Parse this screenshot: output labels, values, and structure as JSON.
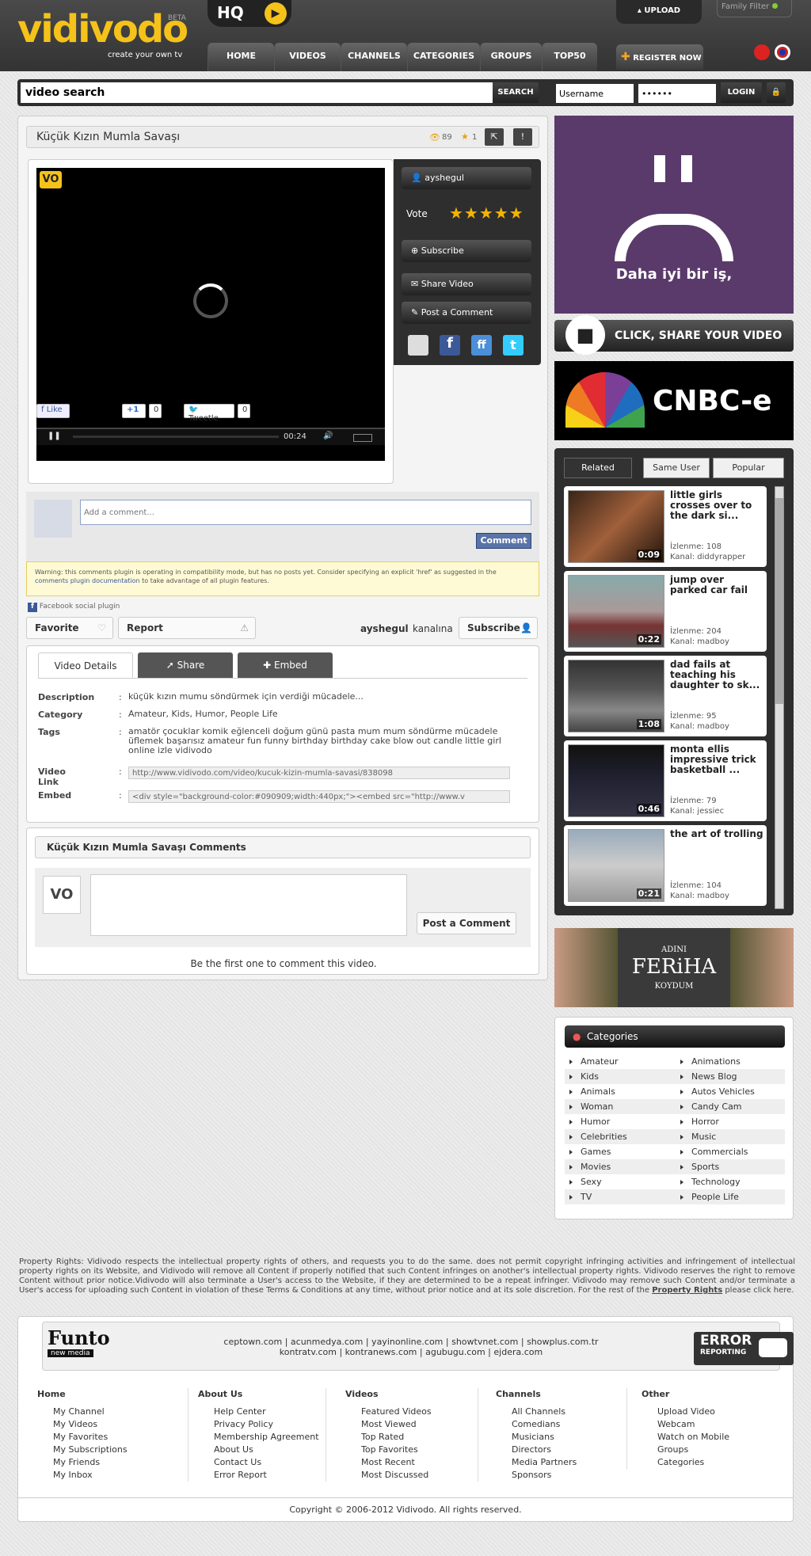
{
  "header": {
    "logo": "vidivodo",
    "beta": "BETA",
    "tagline": "create your own tv",
    "hq": "HQ",
    "upload": "UPLOAD",
    "family_filter": "Family Filter",
    "register": "REGISTER NOW",
    "nav": [
      "HOME",
      "VIDEOS",
      "CHANNELS",
      "CATEGORIES",
      "GROUPS",
      "TOP50"
    ]
  },
  "search": {
    "value": "video search",
    "button": "SEARCH",
    "username": "Username",
    "password": "••••••",
    "login": "LOGIN"
  },
  "video": {
    "title": "Küçük Kızın Mumla Savaşı",
    "views": "89",
    "favs": "1",
    "time": "00:24",
    "owner": "ayshegul",
    "vote_label": "Vote",
    "subscribe": "Subscribe",
    "share": "Share Video",
    "post_comment": "Post a Comment"
  },
  "social": {
    "like": "Like",
    "plus": "+1",
    "plus_count": "0",
    "tweet": "Tweetle",
    "tweet_count": "0"
  },
  "fb": {
    "placeholder": "Add a comment...",
    "comment_btn": "Comment",
    "warning": "Warning: this comments plugin is operating in compatibility mode, but has no posts yet. Consider specifying an explicit 'href' as suggested in the",
    "warning_link": "comments plugin documentation",
    "warning_tail": "to take advantage of all plugin features.",
    "plugin": "Facebook social plugin"
  },
  "actions": {
    "favorite": "Favorite",
    "report": "Report",
    "owner": "ayshegul",
    "kanalina": "kanalına",
    "subscribe": "Subscribe"
  },
  "tabs": {
    "details": "Video Details",
    "share": "Share",
    "embed": "Embed"
  },
  "details": {
    "desc_label": "Description",
    "desc": "küçük kızın mumu söndürmek için verdiği mücadele...",
    "cat_label": "Category",
    "cat": "Amateur, Kids, Humor, People Life",
    "tags_label": "Tags",
    "tags": "amatör çocuklar komik eğlenceli doğum günü pasta mum mum söndürme mücadele üflemek başarısız amateur fun funny birthday birthday cake blow out candle little girl online izle vidivodo",
    "link_label": "Video Link",
    "link": "http://www.vidivodo.com/video/kucuk-kizin-mumla-savasi/838098",
    "embed_label": "Embed",
    "embed": "<div style=\"background-color:#090909;width:440px;\"><embed src=\"http://www.v",
    "colon": ":"
  },
  "comments": {
    "title": "Küçük Kızın Mumla Savaşı Comments",
    "post": "Post a Comment",
    "first": "Be the first one to comment this video.",
    "avatar": "VO"
  },
  "ads": {
    "ad1_text": "Daha iyi bir iş,",
    "ad2": "CLICK, SHARE YOUR VIDEO",
    "cnbc": "CNBC-e",
    "feriha_top": "ADINI",
    "feriha": "FERiHA",
    "feriha_bottom": "KOYDUM"
  },
  "related": {
    "tabs": [
      "Related",
      "Same User",
      "Popular"
    ],
    "items": [
      {
        "title": "little girls crosses over to the dark si...",
        "views": "İzlenme: 108",
        "channel": "Kanal: diddyrapper",
        "dur": "0:09"
      },
      {
        "title": "jump over parked car fail",
        "views": "İzlenme: 204",
        "channel": "Kanal: madboy",
        "dur": "0:22"
      },
      {
        "title": "dad fails at teaching his daughter to sk...",
        "views": "İzlenme: 95",
        "channel": "Kanal: madboy",
        "dur": "1:08"
      },
      {
        "title": "monta ellis impressive trick basketball ...",
        "views": "İzlenme: 79",
        "channel": "Kanal: jessiec",
        "dur": "0:46"
      },
      {
        "title": "the art of trolling",
        "views": "İzlenme: 104",
        "channel": "Kanal: madboy",
        "dur": "0:21"
      }
    ]
  },
  "categories": {
    "title": "Categories",
    "rows": [
      [
        "Amateur",
        "Animations"
      ],
      [
        "Kids",
        "News Blog"
      ],
      [
        "Animals",
        "Autos Vehicles"
      ],
      [
        "Woman",
        "Candy Cam"
      ],
      [
        "Humor",
        "Horror"
      ],
      [
        "Celebrities",
        "Music"
      ],
      [
        "Games",
        "Commercials"
      ],
      [
        "Movies",
        "Sports"
      ],
      [
        "Sexy",
        "Technology"
      ],
      [
        "TV",
        "People Life"
      ]
    ]
  },
  "legal": {
    "text": "Property Rights: Vidivodo respects the intellectual property rights of others, and requests you to do the same. does not permit copyright infringing activities and infringement of intellectual property rights on its Website, and Vidivodo will remove all Content if properly notified that such Content infringes on another's intellectual property rights. Vidivodo reserves the right to remove Content without prior notice.Vidivodo will also terminate a User's access to the Website, if they are determined to be a repeat infringer. Vidivodo may remove such Content and/or terminate a User's access for uploading such Content in violation of these Terms & Conditions at any time, without prior notice and at its sole discretion. For the rest of the",
    "link": "Property Rights",
    "tail": "please click here."
  },
  "footer": {
    "funto": "Funto",
    "funto_sub": "new media",
    "sites1": "ceptown.com | acunmedya.com | yayinonline.com | showtvnet.com | showplus.com.tr",
    "sites2": "kontratv.com | kontranews.com | agubugu.com | ejdera.com",
    "error": "ERROR",
    "error_sub": "REPORTING",
    "cols": [
      {
        "head": "Home",
        "links": [
          "My Channel",
          "My Videos",
          "My Favorites",
          "My Subscriptions",
          "My Friends",
          "My Inbox"
        ]
      },
      {
        "head": "About Us",
        "links": [
          "Help Center",
          "Privacy Policy",
          "Membership Agreement",
          "About Us",
          "Contact Us",
          "Error Report"
        ]
      },
      {
        "head": "Videos",
        "links": [
          "Featured Videos",
          "Most Viewed",
          "Top Rated",
          "Top Favorites",
          "Most Recent",
          "Most Discussed"
        ]
      },
      {
        "head": "Channels",
        "links": [
          "All Channels",
          "Comedians",
          "Musicians",
          "Directors",
          "Media Partners",
          "Sponsors"
        ]
      },
      {
        "head": "Other",
        "links": [
          "Upload Video",
          "Webcam",
          "Watch on Mobile",
          "Groups",
          "Categories"
        ]
      }
    ],
    "copyright": "Copyright © 2006-2012 Vidivodo. All rights reserved."
  }
}
